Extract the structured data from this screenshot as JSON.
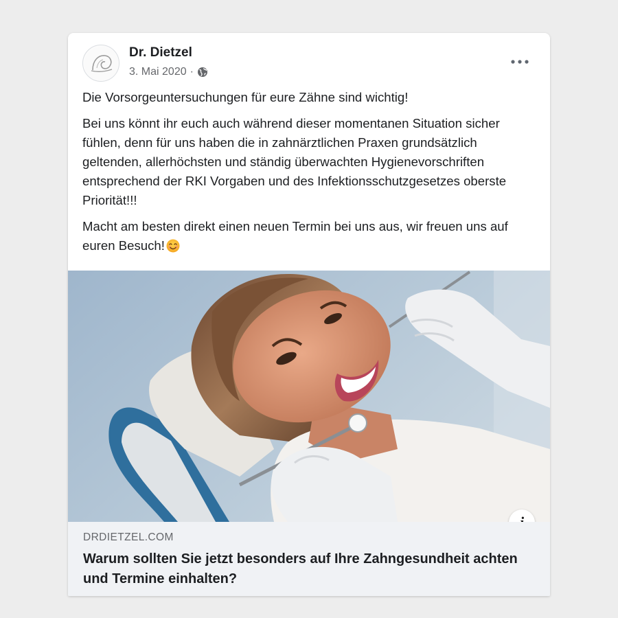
{
  "post": {
    "author": "Dr. Dietzel",
    "date": "3. Mai 2020",
    "separator": "·",
    "privacy_icon": "globe-icon",
    "menu_icon": "more-options-icon",
    "paragraphs": [
      "Die Vorsorgeuntersuchungen für eure Zähne sind wichtig!",
      "Bei uns könnt ihr euch auch während dieser momentanen Situation sicher fühlen, denn für uns haben die in zahnärztlichen Praxen grundsätzlich geltenden, allerhöchsten und ständig überwachten Hygienevorschriften entsprechend der RKI Vorgaben und des Infektionsschutzgesetzes oberste Priorität!!!",
      "Macht am besten direkt einen neuen Termin bei uns aus, wir freuen uns auf euren Besuch!"
    ],
    "emoji": "smiling-face-emoji"
  },
  "link_preview": {
    "image": "smiling-woman-at-dentist-photo",
    "info_label": "i",
    "domain": "DRDIETZEL.COM",
    "title": "Warum sollten Sie jetzt besonders auf Ihre Zahngesundheit achten und Termine einhalten?"
  },
  "colors": {
    "page_background": "#ededed",
    "card_background": "#ffffff",
    "link_background": "#f0f2f5",
    "primary_text": "#1c1e21",
    "secondary_text": "#65676b"
  }
}
